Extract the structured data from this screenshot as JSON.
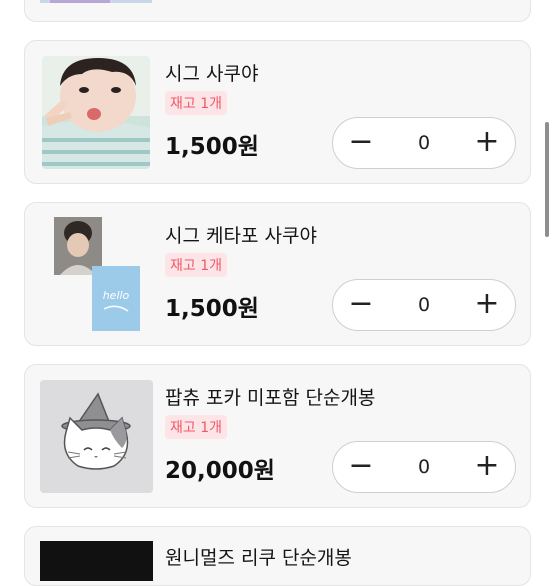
{
  "products": [
    {
      "title": "",
      "badge": "",
      "price": "",
      "qty": "",
      "minus": "−",
      "plus": "+"
    },
    {
      "title": "시그 사쿠야",
      "badge": "재고 1개",
      "price": "1,500원",
      "qty": "0",
      "minus": "−",
      "plus": "+"
    },
    {
      "title": "시그 케타포 사쿠야",
      "badge": "재고 1개",
      "price": "1,500원",
      "qty": "0",
      "minus": "−",
      "plus": "+"
    },
    {
      "title": "팝츄 포카 미포함 단순개봉",
      "badge": "재고 1개",
      "price": "20,000원",
      "qty": "0",
      "minus": "−",
      "plus": "+"
    },
    {
      "title": "원니멀즈 리쿠 단순개봉",
      "badge": "",
      "price": "",
      "qty": "",
      "minus": "",
      "plus": ""
    }
  ],
  "colors": {
    "badge_bg": "#fde4e6",
    "badge_text": "#ef5a69",
    "card_bg": "#f7f7f7"
  },
  "icons": {
    "product2_image2_text": "hello",
    "product4_placeholder": "cat-wizard-placeholder-icon"
  }
}
